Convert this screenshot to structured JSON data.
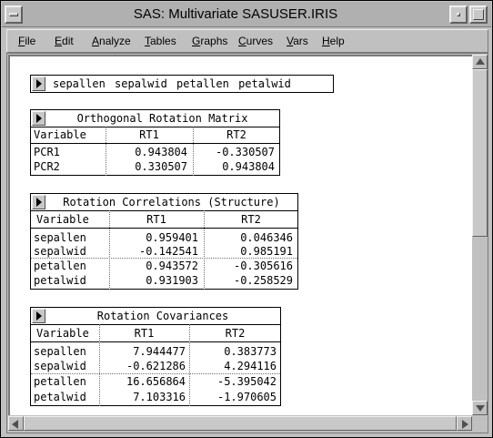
{
  "window": {
    "title": "SAS: Multivariate SASUSER.IRIS"
  },
  "menu": {
    "items": [
      "File",
      "Edit",
      "Analyze",
      "Tables",
      "Graphs",
      "Curves",
      "Vars",
      "Help"
    ]
  },
  "variables": {
    "list": "sepallen  sepalwid  petallen  petalwid"
  },
  "orthogonal": {
    "title": "Orthogonal Rotation Matrix",
    "headers": [
      "Variable",
      "RT1",
      "RT2"
    ],
    "rows": [
      [
        "PCR1",
        "0.943804",
        "-0.330507"
      ],
      [
        "PCR2",
        "0.330507",
        "0.943804"
      ]
    ]
  },
  "correlations": {
    "title": "Rotation Correlations (Structure)",
    "headers": [
      "Variable",
      "RT1",
      "RT2"
    ],
    "rows": [
      [
        "sepallen",
        "0.959401",
        "0.046346"
      ],
      [
        "sepalwid",
        "-0.142541",
        "0.985191"
      ],
      [
        "petallen",
        "0.943572",
        "-0.305616"
      ],
      [
        "petalwid",
        "0.931903",
        "-0.258529"
      ]
    ]
  },
  "covariances": {
    "title": "Rotation Covariances",
    "headers": [
      "Variable",
      "RT1",
      "RT2"
    ],
    "rows": [
      [
        "sepallen",
        "7.944477",
        "0.383773"
      ],
      [
        "sepalwid",
        "-0.621286",
        "4.294116"
      ],
      [
        "petallen",
        "16.656864",
        "-5.395042"
      ],
      [
        "petalwid",
        "7.103316",
        "-1.970605"
      ]
    ]
  }
}
